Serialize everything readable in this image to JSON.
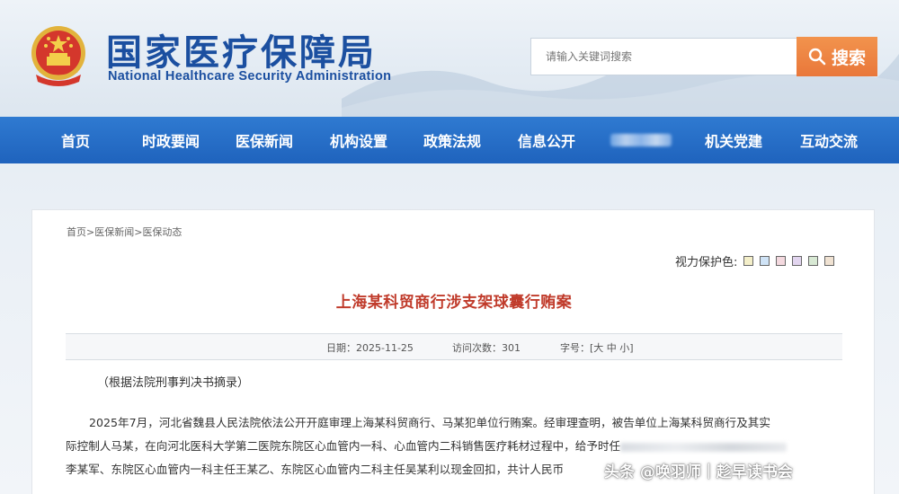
{
  "header": {
    "title_cn": "国家医疗保障局",
    "title_en": "National Healthcare Security Administration",
    "search_placeholder": "请输入关键词搜索",
    "search_label": "搜索"
  },
  "nav": {
    "items": [
      "首页",
      "时政要闻",
      "医保新闻",
      "机构设置",
      "政策法规",
      "信息公开",
      "机关党建",
      "互动交流"
    ]
  },
  "breadcrumb": [
    "首页",
    "医保新闻",
    "医保动态"
  ],
  "vision": {
    "label": "视力保护色:",
    "swatches": [
      "#f4efc9",
      "#cfe3f6",
      "#f4d9df",
      "#e2d5ef",
      "#d8e9d4",
      "#f0e2d2"
    ]
  },
  "article": {
    "title": "上海某科贸商行涉支架球囊行贿案",
    "date_label": "日期：",
    "date": "2025-11-25",
    "visits_label": "访问次数：",
    "visits": "301",
    "fontsize_label": "字号：",
    "fs_open": "[",
    "fs_large": "大",
    "fs_medium": "中",
    "fs_small": "小",
    "fs_close": "]",
    "source_note": "（根据法院刑事判决书摘录）",
    "line1": "2025年7月，河北省魏县人民法院依法公开开庭审理上海某科贸商行、马某犯单位行贿案。经审理查明，被告单位上海某科贸商行及其实",
    "line2": "际控制人马某，在向河北医科大学第二医院东院区心血管内一科、心血管内二科销售医疗耗材过程中，给予时任",
    "line3": "李某军、东院区心血管内一科主任王某乙、东院区心血管内二科主任吴某利以现金回扣，共计人民币"
  },
  "watermark": "头条 @唤羽师｜趁早读书会"
}
